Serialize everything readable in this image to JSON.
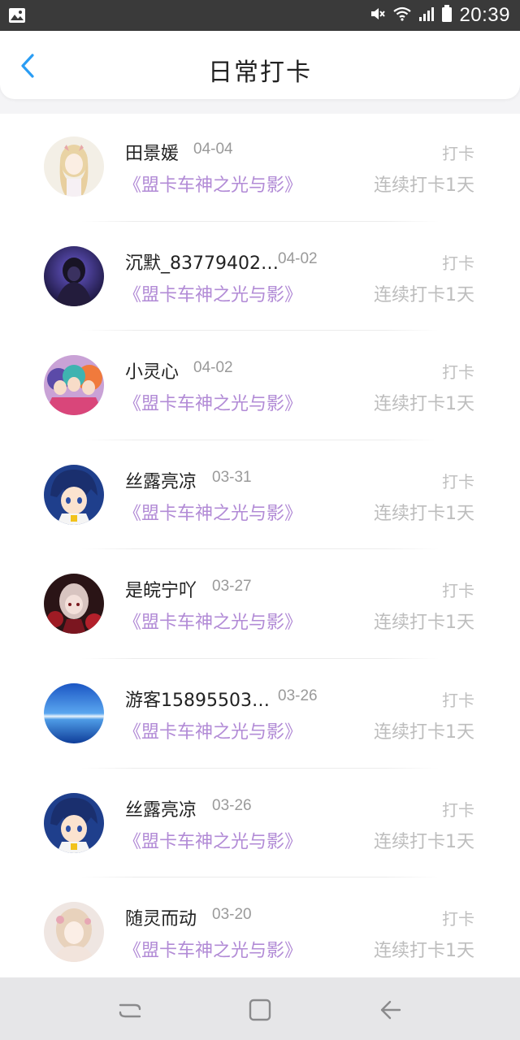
{
  "status_bar": {
    "time": "20:39",
    "icons": [
      "image-icon",
      "mute-icon",
      "wifi-icon",
      "signal-icon",
      "battery-icon"
    ]
  },
  "header": {
    "title": "日常打卡",
    "back_icon": "chevron-left-icon"
  },
  "colors": {
    "book_title": "#b28bd6",
    "back_icon": "#2a9df4",
    "secondary_text": "#bdbdbd"
  },
  "list": {
    "items": [
      {
        "name": "田景媛",
        "date": "04-04",
        "book": "《盟卡车神之光与影》",
        "action": "打卡",
        "streak": "连续打卡1天"
      },
      {
        "name": "沉默_83779402…",
        "date": "04-02",
        "book": "《盟卡车神之光与影》",
        "action": "打卡",
        "streak": "连续打卡1天"
      },
      {
        "name": "小灵心",
        "date": "04-02",
        "book": "《盟卡车神之光与影》",
        "action": "打卡",
        "streak": "连续打卡1天"
      },
      {
        "name": "丝露亮凉",
        "date": "03-31",
        "book": "《盟卡车神之光与影》",
        "action": "打卡",
        "streak": "连续打卡1天"
      },
      {
        "name": "是皖宁吖",
        "date": "03-27",
        "book": "《盟卡车神之光与影》",
        "action": "打卡",
        "streak": "连续打卡1天"
      },
      {
        "name": "游客15895503…",
        "date": "03-26",
        "book": "《盟卡车神之光与影》",
        "action": "打卡",
        "streak": "连续打卡1天"
      },
      {
        "name": "丝露亮凉",
        "date": "03-26",
        "book": "《盟卡车神之光与影》",
        "action": "打卡",
        "streak": "连续打卡1天"
      },
      {
        "name": "随灵而动",
        "date": "03-20",
        "book": "《盟卡车神之光与影》",
        "action": "打卡",
        "streak": "连续打卡1天"
      }
    ]
  },
  "nav_bar": {
    "icons": [
      "recent-apps-icon",
      "home-icon",
      "back-icon"
    ]
  }
}
